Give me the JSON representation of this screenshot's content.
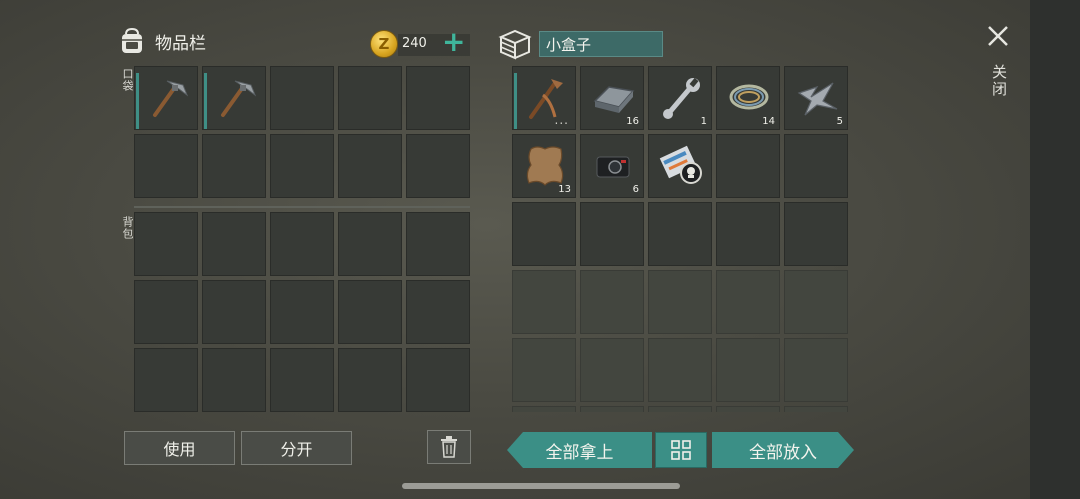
{
  "inventory": {
    "title": "物品栏",
    "coins": "240",
    "add_symbol": "+",
    "pocket_label": "口袋",
    "backpack_label": "背包",
    "pocket": [
      {
        "item": "pickaxe",
        "selected": true,
        "qty": ""
      },
      {
        "item": "pickaxe",
        "selected": true,
        "qty": ""
      },
      {},
      {},
      {},
      {},
      {},
      {},
      {},
      {}
    ],
    "backpack_rows": 3,
    "backpack_cols": 5
  },
  "container": {
    "name": "小盒子",
    "slots": [
      {
        "item": "pickaxe-crude",
        "selected": true,
        "qty": "...",
        "dots": true
      },
      {
        "item": "metal-ingot",
        "qty": "16"
      },
      {
        "item": "wrench",
        "qty": "1"
      },
      {
        "item": "wire-coil",
        "qty": "14"
      },
      {
        "item": "scrap-metal",
        "qty": "5"
      },
      {
        "item": "leather-hide",
        "qty": "13"
      },
      {
        "item": "camera",
        "qty": "6"
      },
      {
        "item": "blueprint-scroll",
        "qty": ""
      }
    ],
    "active_rows": 3,
    "dim_rows": 3,
    "cols": 5
  },
  "close_label": "关闭",
  "buttons": {
    "use": "使用",
    "split": "分开",
    "take_all": "全部拿上",
    "put_all": "全部放入"
  },
  "colors": {
    "accent": "#3b8f86",
    "coin": "#d8a520",
    "add": "#3fb59b"
  }
}
